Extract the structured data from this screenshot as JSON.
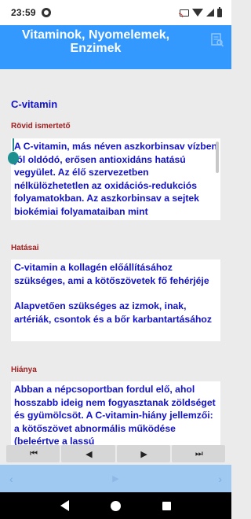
{
  "status_bar": {
    "time": "23:59"
  },
  "app_bar": {
    "title": "Vitaminok, Nyomelemek, Enzimek"
  },
  "section": {
    "title": "C-vitamin"
  },
  "fields": [
    {
      "label": "Rövid ismertető",
      "paragraphs": [
        "A C-vitamin, más néven aszkorbinsav vízben jól oldódó, erősen antioxidáns hatású vegyület. Az élő szervezetben nélkülözhetetlen az oxidációs-redukciós folyamatokban. Az aszkorbinsav a sejtek biokémiai folyamataiban mint hidrogéndonor vesz részt, ez adja meg"
      ]
    },
    {
      "label": "Hatásai",
      "paragraphs": [
        "C-vitamin a kollagén előállításához szükséges, ami a kötőszövetek fő fehérjéje",
        "Alapvetően szükséges az izmok, inak, artériák, csontok és a bőr karbantartásához"
      ]
    },
    {
      "label": "Hiánya",
      "paragraphs": [
        "Abban a népcsoportban fordul elő, ahol hosszabb ideig nem fogyasztanak zöldséget és gyümölcsöt. A C-vitamin-hiány jellemzői: a kötőszövet abnormális működése (beleértve a lassú"
      ]
    }
  ],
  "nav_buttons": {
    "first": "⏮",
    "prev": "◀",
    "next": "▶",
    "last": "⏭"
  },
  "pager": {
    "left": "‹",
    "middle": "▶",
    "right": "›"
  },
  "icons": {
    "app_menu": "document-search-icon",
    "back": "back-icon",
    "home": "home-icon",
    "recents": "recents-icon"
  },
  "colors": {
    "app_bar": "#3399ff",
    "body_text": "#1212c8",
    "label": "#a02020",
    "pager": "#9fc9f0"
  }
}
